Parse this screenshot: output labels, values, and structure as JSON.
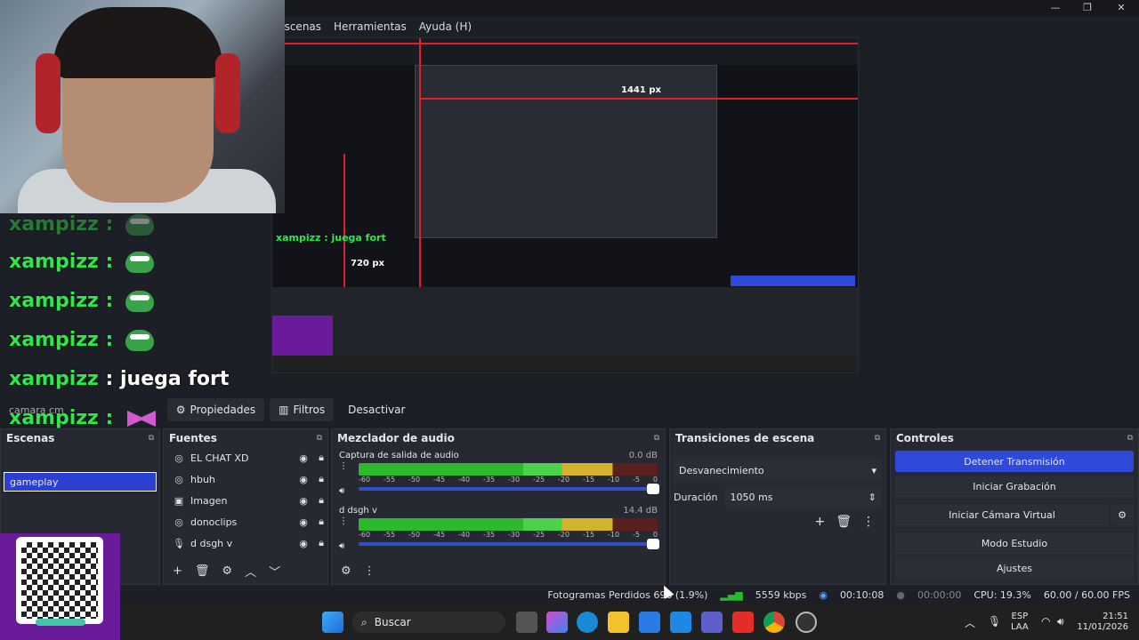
{
  "menu": [
    "Escenas",
    "Herramientas",
    "Ayuda (H)"
  ],
  "preview": {
    "inner_label_width": "1441 px",
    "inner_label_height": "720 px",
    "inner_chat_line": "xampizz : juega fort"
  },
  "chat": {
    "user": "xampizz",
    "separator": " : ",
    "message": "juega fort"
  },
  "camera_source_label": "camara cm",
  "toolbar": {
    "properties": "Propiedades",
    "filters": "Filtros",
    "deactivate": "Desactivar"
  },
  "scenes": {
    "title": "Escenas",
    "items": [
      "gameplay"
    ]
  },
  "sources": {
    "title": "Fuentes",
    "items": [
      "EL CHAT XD",
      "hbuh",
      "Imagen",
      "donoclips",
      "d dsgh v"
    ]
  },
  "mixer": {
    "title": "Mezclador de audio",
    "channels": [
      {
        "name": "Captura de salida de audio",
        "level": "0.0 dB"
      },
      {
        "name": "d dsgh v",
        "level": "14.4 dB"
      }
    ],
    "scale": [
      "-60",
      "-55",
      "-50",
      "-45",
      "-40",
      "-35",
      "-30",
      "-25",
      "-20",
      "-15",
      "-10",
      "-5",
      "0"
    ]
  },
  "transitions": {
    "title": "Transiciones de escena",
    "type": "Desvanecimiento",
    "duration_label": "Duración",
    "duration_value": "1050 ms"
  },
  "controls": {
    "title": "Controles",
    "stop_stream": "Detener Transmisión",
    "start_recording": "Iniciar Grabación",
    "start_virtual_cam": "Iniciar Cámara Virtual",
    "studio_mode": "Modo Estudio",
    "settings": "Ajustes"
  },
  "status": {
    "dropped_frames": "Fotogramas Perdidos 696 (1.9%)",
    "bitrate": "5559 kbps",
    "stream_time": "00:10:08",
    "rec_time": "00:00:00",
    "cpu": "CPU: 19.3%",
    "fps": "60.00 / 60.00 FPS"
  },
  "taskbar": {
    "search": "Buscar",
    "lang_top": "ESP",
    "lang_bottom": "LAA",
    "time": "21:51",
    "date": "11/01/2026"
  },
  "colors": {
    "accent": "#2f4ad9",
    "chat_user": "#2ee84a",
    "red_guides": "#e0212a"
  }
}
